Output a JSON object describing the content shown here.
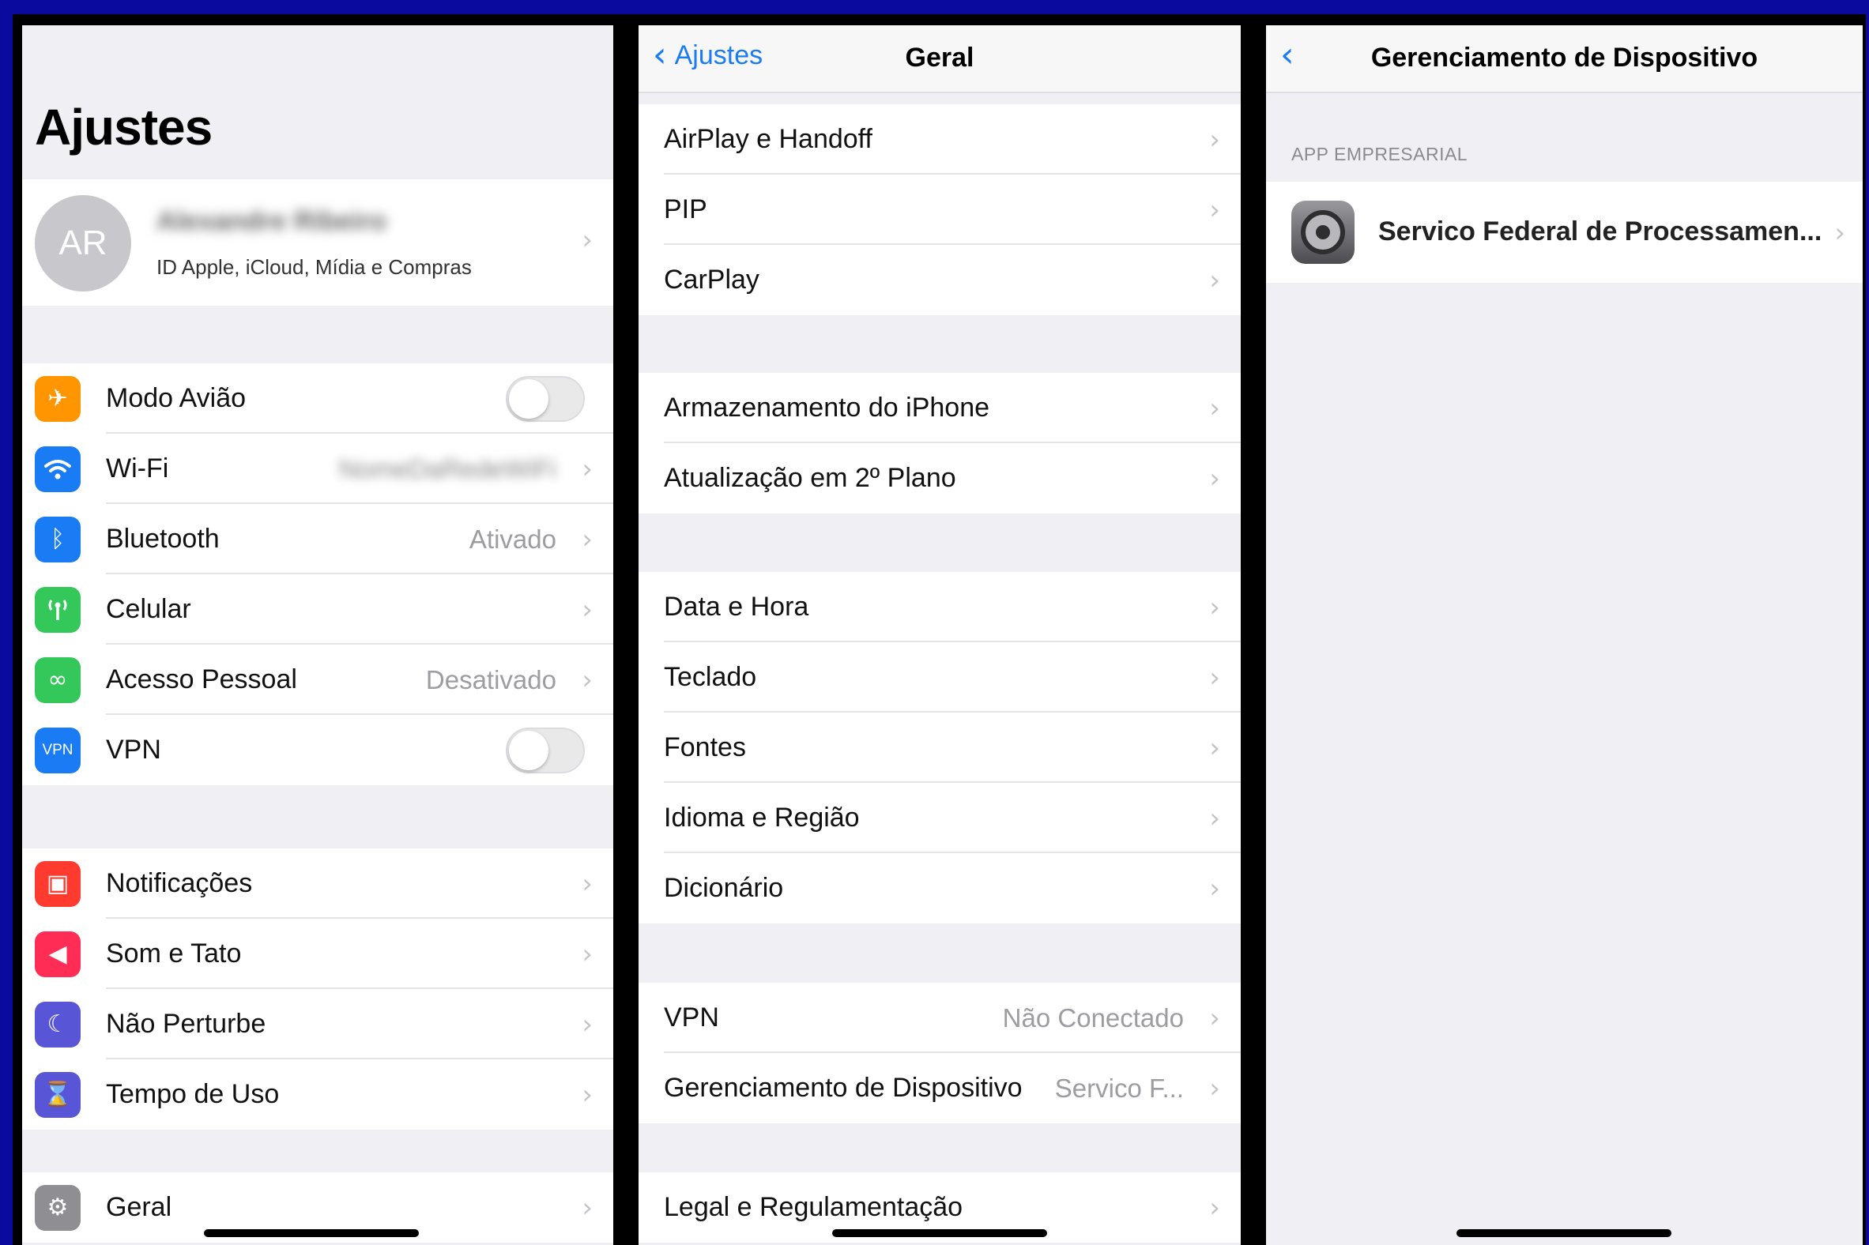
{
  "settings": {
    "title": "Ajustes",
    "profile": {
      "initials": "AR",
      "name": "Alexandre Ribeiro",
      "subtitle": "ID Apple, iCloud, Mídia e Compras"
    },
    "group1": [
      {
        "label": "Modo Avião",
        "value": "",
        "icon": "airplane-icon",
        "color": "#ff9500",
        "glyph": "✈",
        "toggle": true
      },
      {
        "label": "Wi-Fi",
        "value": "NomeDaRedeWiFi",
        "icon": "wifi-icon",
        "color": "#1a7cf5",
        "glyph": "◔",
        "toggle": false
      },
      {
        "label": "Bluetooth",
        "value": "Ativado",
        "icon": "bluetooth-icon",
        "color": "#1a7cf5",
        "glyph": "ᛒ",
        "toggle": false
      },
      {
        "label": "Celular",
        "value": "",
        "icon": "antenna-icon",
        "color": "#34c759",
        "glyph": "⊥",
        "toggle": false
      },
      {
        "label": "Acesso Pessoal",
        "value": "Desativado",
        "icon": "link-icon",
        "color": "#34c759",
        "glyph": "∞",
        "toggle": false
      },
      {
        "label": "VPN",
        "value": "",
        "icon": "vpn-icon",
        "color": "#1a7cf5",
        "glyph": "VPN",
        "toggle": true
      }
    ],
    "group2": [
      {
        "label": "Notificações",
        "icon": "notifications-icon",
        "color": "#ff3b30",
        "glyph": "▣"
      },
      {
        "label": "Som e Tato",
        "icon": "speaker-icon",
        "color": "#ff2d55",
        "glyph": "◀"
      },
      {
        "label": "Não Perturbe",
        "icon": "moon-icon",
        "color": "#5856d6",
        "glyph": "☾"
      },
      {
        "label": "Tempo de Uso",
        "icon": "hourglass-icon",
        "color": "#5856d6",
        "glyph": "⌛"
      }
    ],
    "group3": [
      {
        "label": "Geral",
        "icon": "gear-icon",
        "color": "#8e8e93",
        "glyph": "⚙"
      }
    ]
  },
  "general": {
    "back_label": "Ajustes",
    "title": "Geral",
    "group1": [
      "AirPlay e Handoff",
      "PIP",
      "CarPlay"
    ],
    "group2": [
      "Armazenamento do iPhone",
      "Atualização em 2º Plano"
    ],
    "group3": [
      "Data e Hora",
      "Teclado",
      "Fontes",
      "Idioma e Região",
      "Dicionário"
    ],
    "group4": [
      {
        "label": "VPN",
        "value": "Não Conectado"
      },
      {
        "label": "Gerenciamento de Dispositivo",
        "value": "Servico F..."
      }
    ],
    "group5": [
      "Legal e Regulamentação"
    ]
  },
  "device": {
    "title": "Gerenciamento de Dispositivo",
    "section_header": "APP EMPRESARIAL",
    "app_name": "Servico Federal de Processamen..."
  },
  "colors": {
    "accent": "#1a7cf5",
    "frame": "#0a0a9e",
    "background": "#efeff4"
  }
}
